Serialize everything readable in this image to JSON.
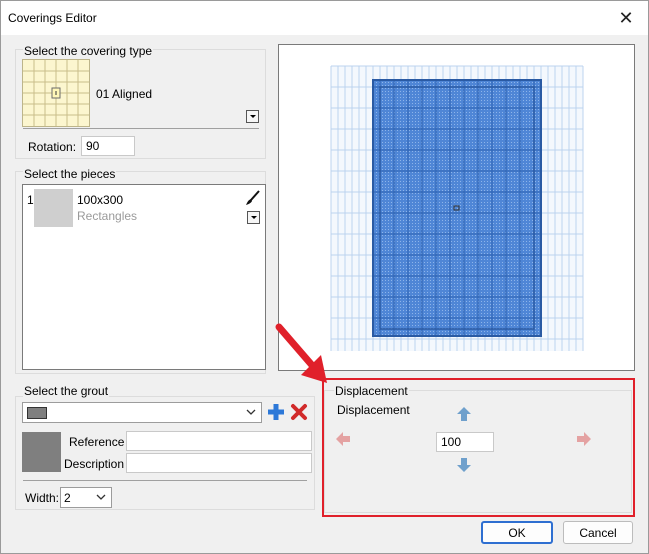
{
  "window": {
    "title": "Coverings Editor",
    "close_glyph": "✕"
  },
  "covering_type": {
    "group_label": "Select the covering type",
    "selected_name": "01 Aligned",
    "rotation_label": "Rotation:",
    "rotation_value": "90"
  },
  "pieces": {
    "group_label": "Select the pieces",
    "items": [
      {
        "index": "1",
        "size": "100x300",
        "shape": "Rectangles"
      }
    ]
  },
  "grout": {
    "group_label": "Select the grout",
    "selected_value": "",
    "reference_label": "Reference",
    "reference_value": "",
    "description_label": "Description",
    "description_value": "",
    "width_label": "Width:",
    "width_value": "2",
    "swatch_color": "#7f7f7f"
  },
  "displacement": {
    "group_label": "Displacement",
    "inner_label": "Displacement",
    "value": "100",
    "highlight_color": "#e0202a"
  },
  "footer": {
    "ok_label": "OK",
    "cancel_label": "Cancel"
  },
  "icons": {
    "add": "plus-icon",
    "delete": "delete-x-icon",
    "edit": "paintbrush-icon",
    "up": "arrow-up-icon",
    "down": "arrow-down-icon",
    "left": "arrow-left-icon",
    "right": "arrow-right-icon"
  }
}
